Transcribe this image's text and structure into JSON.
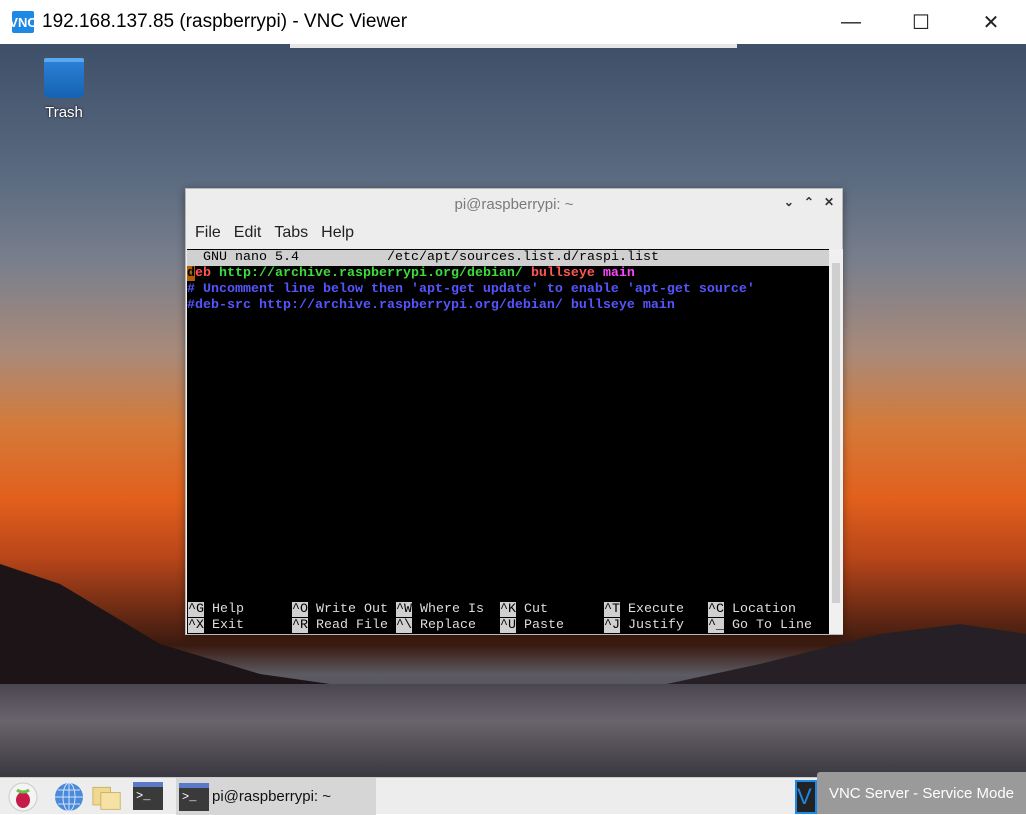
{
  "window": {
    "title": "192.168.137.85 (raspberrypi) - VNC Viewer",
    "logo": "VNC",
    "controls": [
      "minimize-icon",
      "maximize-icon",
      "close-icon"
    ]
  },
  "desktop": {
    "trash_label": "Trash"
  },
  "terminal": {
    "title": "pi@raspberrypi: ~",
    "menu": [
      "File",
      "Edit",
      "Tabs",
      "Help"
    ],
    "header": {
      "app": "GNU nano 5.4",
      "file": "/etc/apt/sources.list.d/raspi.list"
    },
    "lines": [
      {
        "cursor": "d",
        "kw": "eb",
        "url": "http://archive.raspberrypi.org/debian/",
        "dist": "bullseye",
        "comp": "main"
      },
      {
        "comment": "# Uncomment line below then 'apt-get update' to enable 'apt-get source'"
      },
      {
        "comment": "#deb-src http://archive.raspberrypi.org/debian/ bullseye main"
      }
    ],
    "shortcuts": [
      [
        {
          "key": "^G",
          "label": "Help"
        },
        {
          "key": "^O",
          "label": "Write Out"
        },
        {
          "key": "^W",
          "label": "Where Is"
        },
        {
          "key": "^K",
          "label": "Cut"
        },
        {
          "key": "^T",
          "label": "Execute"
        },
        {
          "key": "^C",
          "label": "Location"
        }
      ],
      [
        {
          "key": "^X",
          "label": "Exit"
        },
        {
          "key": "^R",
          "label": "Read File"
        },
        {
          "key": "^\\",
          "label": "Replace"
        },
        {
          "key": "^U",
          "label": "Paste"
        },
        {
          "key": "^J",
          "label": "Justify"
        },
        {
          "key": "^_",
          "label": "Go To Line"
        }
      ]
    ]
  },
  "taskbar": {
    "icons": [
      "raspberry-menu-icon",
      "browser-globe-icon",
      "file-manager-folder-icon",
      "terminal-icon"
    ],
    "task_label": "pi@raspberrypi: ~",
    "terminal_glyph": ">_",
    "tray_glyph": "V",
    "tooltip": "VNC Server - Service Mode"
  }
}
